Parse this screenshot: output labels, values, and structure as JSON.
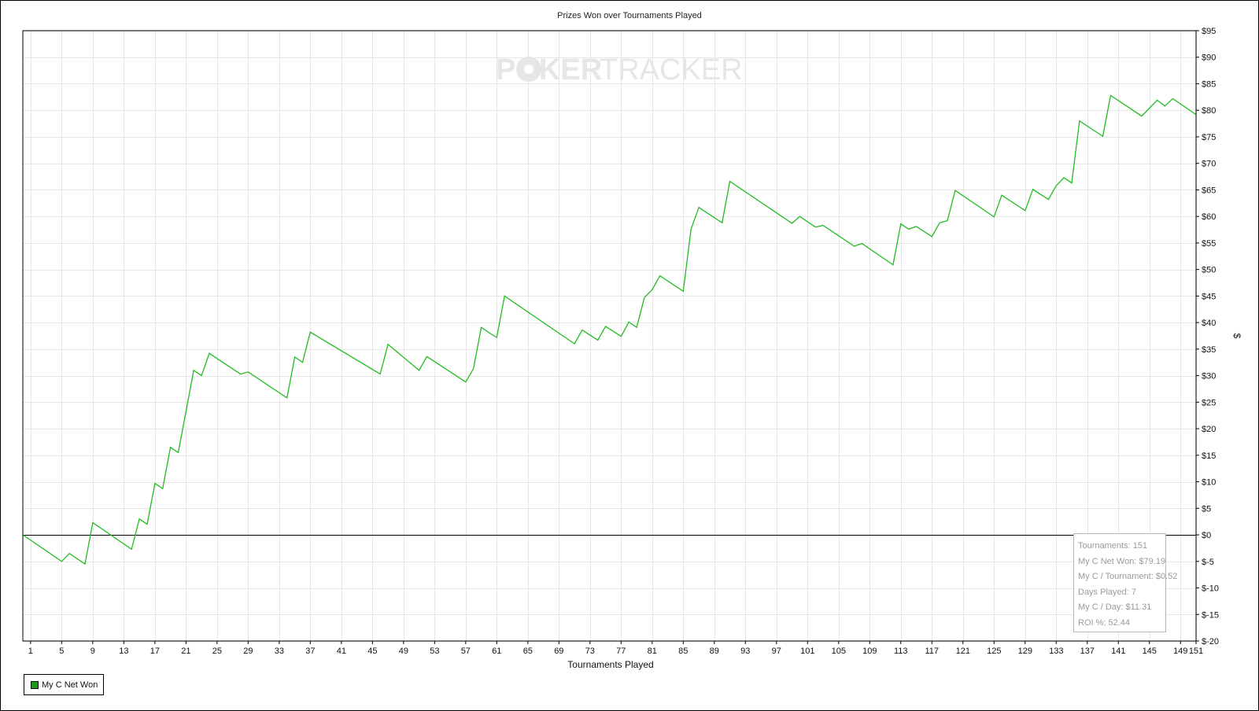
{
  "chart_data": {
    "type": "line",
    "title": "Prizes Won over Tournaments Played",
    "xlabel": "Tournaments Played",
    "ylabel": "$",
    "xlim": [
      0,
      151
    ],
    "ylim": [
      -20,
      95
    ],
    "y_ticks": [
      95,
      90,
      85,
      80,
      75,
      70,
      65,
      60,
      55,
      50,
      45,
      40,
      35,
      30,
      25,
      20,
      15,
      10,
      5,
      0,
      -5,
      -10,
      -15,
      -20
    ],
    "y_tick_labels": [
      "$95",
      "$90",
      "$85",
      "$80",
      "$75",
      "$70",
      "$65",
      "$60",
      "$55",
      "$50",
      "$45",
      "$40",
      "$35",
      "$30",
      "$25",
      "$20",
      "$15",
      "$10",
      "$5",
      "$0",
      "$-5",
      "$-10",
      "$-15",
      "$-20"
    ],
    "x_ticks": [
      1,
      5,
      9,
      13,
      17,
      21,
      25,
      29,
      33,
      37,
      41,
      45,
      49,
      53,
      57,
      61,
      65,
      69,
      73,
      77,
      81,
      85,
      89,
      93,
      97,
      101,
      105,
      109,
      113,
      117,
      121,
      125,
      129,
      133,
      137,
      141,
      145,
      149,
      151
    ],
    "x_tick_labels": [
      "1",
      "5",
      "9",
      "13",
      "17",
      "21",
      "25",
      "29",
      "33",
      "37",
      "41",
      "45",
      "49",
      "53",
      "57",
      "61",
      "65",
      "69",
      "73",
      "77",
      "81",
      "85",
      "89",
      "93",
      "97",
      "101",
      "105",
      "109",
      "113",
      "117",
      "121",
      "125",
      "129",
      "133",
      "137",
      "141",
      "145",
      "149",
      "151"
    ],
    "grid": true,
    "legend_position": "bottom-left",
    "series": [
      {
        "name": "My C Net Won",
        "color": "#22bb22",
        "legend_color": "#1a9a1a",
        "x": [
          0,
          5,
          6,
          8,
          9,
          14,
          15,
          16,
          17,
          18,
          19,
          20,
          22,
          23,
          24,
          28,
          29,
          34,
          35,
          36,
          37,
          46,
          47,
          51,
          52,
          57,
          58,
          59,
          60,
          61,
          62,
          71,
          72,
          74,
          75,
          77,
          78,
          79,
          80,
          81,
          82,
          85,
          86,
          87,
          90,
          91,
          99,
          100,
          102,
          103,
          107,
          108,
          112,
          113,
          114,
          115,
          117,
          118,
          119,
          120,
          125,
          126,
          129,
          130,
          132,
          133,
          134,
          135,
          136,
          139,
          140,
          144,
          146,
          147,
          148,
          151
        ],
        "y": [
          0,
          -5,
          -3.5,
          -5.5,
          2.3,
          -2.7,
          3,
          2,
          9.7,
          8.7,
          16.5,
          15.5,
          31,
          30,
          34.2,
          30.3,
          30.7,
          25.8,
          33.5,
          32.5,
          38.2,
          30.3,
          35.9,
          31,
          33.6,
          28.8,
          31.3,
          39.1,
          38.1,
          37.2,
          45,
          36,
          38.6,
          36.7,
          39.3,
          37.4,
          40.1,
          39.1,
          44.7,
          46.2,
          48.8,
          45.9,
          57.6,
          61.7,
          58.8,
          66.6,
          58.7,
          60,
          58,
          58.3,
          54.4,
          54.9,
          50.9,
          58.6,
          57.6,
          58.1,
          56.2,
          58.8,
          59.2,
          64.9,
          59.9,
          64,
          61.1,
          65.1,
          63.2,
          65.8,
          67.3,
          66.3,
          78,
          75.1,
          82.8,
          78.9,
          81.9,
          80.8,
          82.2,
          79.2
        ]
      }
    ]
  },
  "stats": {
    "tournaments": "Tournaments: 151",
    "net_won": "My C Net Won: $79.19",
    "per_tournament": "My C / Tournament: $0.52",
    "days_played": "Days Played: 7",
    "per_day": "My C / Day: $11.31",
    "roi": "ROI %: 52.44"
  },
  "watermark": {
    "part1": "POKER",
    "part2": "TRACKER"
  },
  "colors": {
    "series": "#22bb22",
    "grid": "#e6e6e6",
    "zero_line": "#000000"
  }
}
